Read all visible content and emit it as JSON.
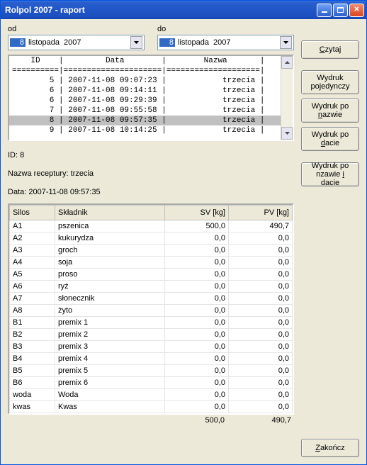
{
  "window": {
    "title": "Rolpol 2007 - raport"
  },
  "date_from": {
    "label": "od",
    "day": "8",
    "month": "listopada",
    "year": "2007"
  },
  "date_to": {
    "label": "do",
    "day": "8",
    "month": "listopada",
    "year": "2007"
  },
  "buttons": {
    "czytaj": "Czytaj",
    "wydruk_poj": "Wydruk pojedynczy",
    "wydruk_naz": "Wydruk po nazwie",
    "wydruk_dac": "Wydruk po dacie",
    "wydruk_nzd": "Wydruk po nzawie i dacie",
    "zakoncz": "Zakończ"
  },
  "list": {
    "header": "    ID    |         Data        |        Nazwa       |",
    "divider": "==========|=====================|====================|",
    "rows": [
      {
        "id": "5",
        "data": "2007-11-08 09:07:23",
        "nazwa": "trzecia",
        "sel": false
      },
      {
        "id": "6",
        "data": "2007-11-08 09:14:11",
        "nazwa": "trzecia",
        "sel": false
      },
      {
        "id": "6",
        "data": "2007-11-08 09:29:39",
        "nazwa": "trzecia",
        "sel": false
      },
      {
        "id": "7",
        "data": "2007-11-08 09:55:58",
        "nazwa": "trzecia",
        "sel": false
      },
      {
        "id": "8",
        "data": "2007-11-08 09:57:35",
        "nazwa": "trzecia",
        "sel": true
      },
      {
        "id": "9",
        "data": "2007-11-08 10:14:25",
        "nazwa": "trzecia",
        "sel": false
      }
    ]
  },
  "details": {
    "id_label": "ID: 8",
    "name_label": "Nazwa receptury: trzecia",
    "date_label": "Data: 2007-11-08 09:57:35"
  },
  "grid": {
    "columns": [
      "Silos",
      "Składnik",
      "SV [kg]",
      "PV [kg]"
    ],
    "rows": [
      {
        "silos": "A1",
        "skladnik": "pszenica",
        "sv": "500,0",
        "pv": "490,7"
      },
      {
        "silos": "A2",
        "skladnik": "kukurydza",
        "sv": "0,0",
        "pv": "0,0"
      },
      {
        "silos": "A3",
        "skladnik": "groch",
        "sv": "0,0",
        "pv": "0,0"
      },
      {
        "silos": "A4",
        "skladnik": "soja",
        "sv": "0,0",
        "pv": "0,0"
      },
      {
        "silos": "A5",
        "skladnik": "proso",
        "sv": "0,0",
        "pv": "0,0"
      },
      {
        "silos": "A6",
        "skladnik": "ryż",
        "sv": "0,0",
        "pv": "0,0"
      },
      {
        "silos": "A7",
        "skladnik": "słonecznik",
        "sv": "0,0",
        "pv": "0,0"
      },
      {
        "silos": "A8",
        "skladnik": "żyto",
        "sv": "0,0",
        "pv": "0,0"
      },
      {
        "silos": "B1",
        "skladnik": "premix 1",
        "sv": "0,0",
        "pv": "0,0"
      },
      {
        "silos": "B2",
        "skladnik": "premix 2",
        "sv": "0,0",
        "pv": "0,0"
      },
      {
        "silos": "B3",
        "skladnik": "premix 3",
        "sv": "0,0",
        "pv": "0,0"
      },
      {
        "silos": "B4",
        "skladnik": "premix 4",
        "sv": "0,0",
        "pv": "0,0"
      },
      {
        "silos": "B5",
        "skladnik": "premix 5",
        "sv": "0,0",
        "pv": "0,0"
      },
      {
        "silos": "B6",
        "skladnik": "premix 6",
        "sv": "0,0",
        "pv": "0,0"
      },
      {
        "silos": "woda",
        "skladnik": "Woda",
        "sv": "0,0",
        "pv": "0,0"
      },
      {
        "silos": "kwas",
        "skladnik": "Kwas",
        "sv": "0,0",
        "pv": "0,0"
      }
    ],
    "totals": {
      "sv": "500,0",
      "pv": "490,7"
    }
  }
}
